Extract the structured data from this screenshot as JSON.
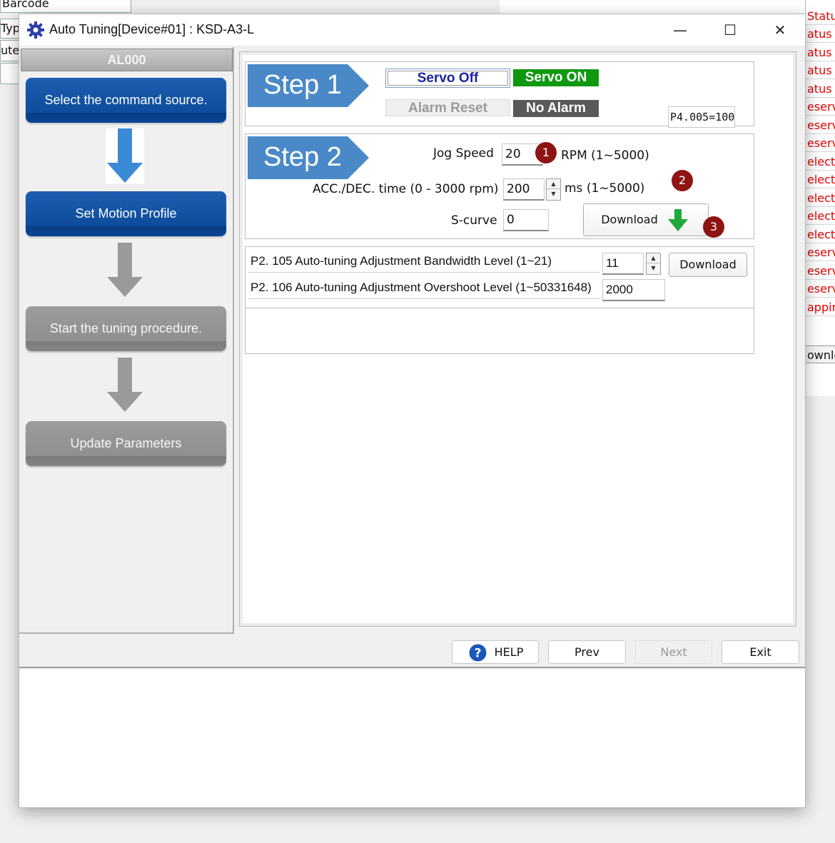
{
  "background_app": {
    "strips": [
      "Barcode",
      "Typ",
      "uter"
    ],
    "right_column": [
      "Status m",
      "atus m",
      "atus m",
      "atus m",
      "atus m",
      "eserve",
      "eserve",
      "eserve",
      "elect c",
      "elect c",
      "elect c",
      "elect c",
      "elect c",
      "eserve",
      "eserve",
      "eserve",
      "apping"
    ],
    "right_bottom": "ownlo"
  },
  "window": {
    "title": "Auto Tuning[Device#01]  : KSD-A3-L",
    "icon": "gear-icon",
    "controls": {
      "minimize": "—",
      "maximize": "☐",
      "close": "✕"
    }
  },
  "left_panel": {
    "alarm_code": "AL000",
    "steps": [
      {
        "label": "Select the command source.",
        "state": "active"
      },
      {
        "label": "Set Motion Profile",
        "state": "active"
      },
      {
        "label": "Start the tuning procedure.",
        "state": "inactive"
      },
      {
        "label": "Update Parameters",
        "state": "inactive"
      }
    ],
    "arrow_colors": [
      "#3a8ad6",
      "#9a9a9a",
      "#9a9a9a"
    ]
  },
  "step1": {
    "title": "Step 1",
    "servo_off": "Servo Off",
    "servo_on": "Servo ON",
    "alarm_reset": "Alarm Reset",
    "no_alarm": "No Alarm",
    "param_readout": "P4.005=100",
    "colors": {
      "servo_on_bg": "#119811",
      "no_alarm_bg": "#595959",
      "chevron": "#4a89c8"
    }
  },
  "step2": {
    "title": "Step 2",
    "jog_speed_label": "Jog Speed",
    "jog_speed_value": "20",
    "jog_speed_unit": "RPM (1~5000)",
    "accdec_label": "ACC./DEC. time (0 - 3000 rpm)",
    "accdec_value": "200",
    "accdec_unit": "ms (1~5000)",
    "scurve_label": "S-curve",
    "scurve_value": "0",
    "download_label": "Download",
    "badges": [
      "1",
      "2",
      "3"
    ]
  },
  "params": {
    "rows": [
      {
        "label": "P2. 105 Auto-tuning Adjustment Bandwidth Level (1~21)",
        "value": "11"
      },
      {
        "label": "P2. 106 Auto-tuning Adjustment Overshoot Level (1~50331648)",
        "value": "2000"
      }
    ],
    "download_label": "Download"
  },
  "bottom": {
    "help": "HELP",
    "prev": "Prev",
    "next": "Next",
    "exit": "Exit"
  }
}
